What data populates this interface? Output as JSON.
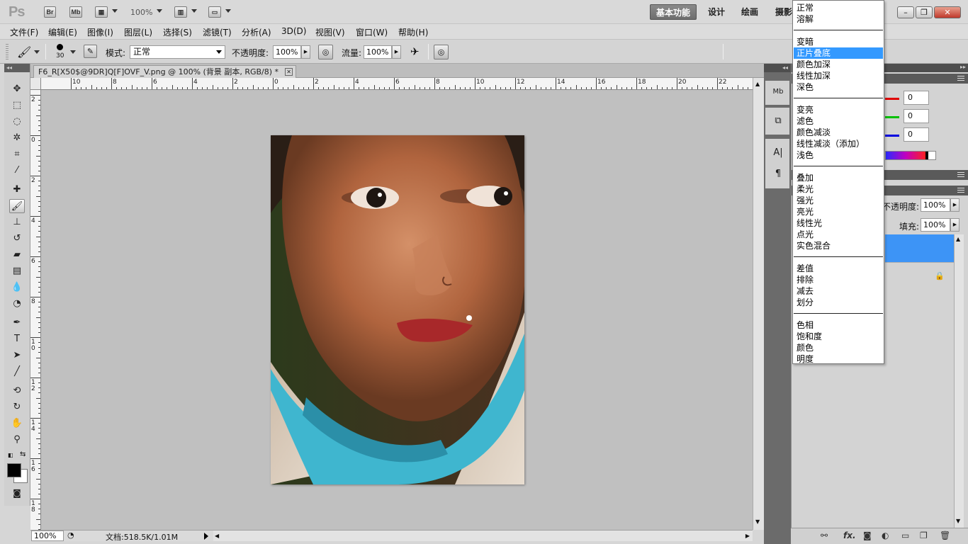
{
  "app": {
    "logo": "Ps",
    "bridge_label": "Br",
    "minibridge_label": "Mb",
    "zoom_level": "100%",
    "workspaces": [
      "基本功能",
      "设计",
      "绘画",
      "摄影"
    ],
    "window_buttons": [
      "–",
      "❐",
      "✕"
    ]
  },
  "menu": [
    "文件(F)",
    "编辑(E)",
    "图像(I)",
    "图层(L)",
    "选择(S)",
    "滤镜(T)",
    "分析(A)",
    "3D(D)",
    "视图(V)",
    "窗口(W)",
    "帮助(H)"
  ],
  "options": {
    "brush_size": "30",
    "mode_label": "模式:",
    "mode_value": "正常",
    "opacity_label": "不透明度:",
    "opacity_value": "100%",
    "flow_label": "流量:",
    "flow_value": "100%"
  },
  "document": {
    "tab_title": "F6_R[X50$@9DR]Q[F]OVF_V.png @ 100% (背景 副本, RGB/8) *",
    "zoom": "100%",
    "doc_info": "文档:518.5K/1.01M",
    "ruler_top": [
      "10",
      "8",
      "6",
      "4",
      "2",
      "0",
      "2",
      "4",
      "6",
      "8",
      "10",
      "12",
      "14",
      "16",
      "18",
      "20",
      "22"
    ],
    "ruler_left": [
      "2",
      "0",
      "2",
      "4",
      "6",
      "8",
      "10",
      "12",
      "14",
      "16",
      "18"
    ]
  },
  "colors": {
    "rgb_values": [
      "0",
      "0",
      "0"
    ],
    "r_color": "#e00000",
    "g_color": "#00c000",
    "b_color": "#0000e0"
  },
  "layers": {
    "opacity_label": "不透明度:",
    "opacity_value": "100%",
    "fill_label": "填充:",
    "fill_value": "100%",
    "footer_icons": [
      "link-icon",
      "fx-icon",
      "mask-icon",
      "adjustment-icon",
      "group-icon",
      "new-layer-icon",
      "trash-icon"
    ],
    "fx_label": "fx."
  },
  "blend_menu": {
    "groups": [
      [
        "正常",
        "溶解"
      ],
      [
        "变暗",
        "正片叠底",
        "颜色加深",
        "线性加深",
        "深色"
      ],
      [
        "变亮",
        "滤色",
        "颜色减淡",
        "线性减淡（添加）",
        "浅色"
      ],
      [
        "叠加",
        "柔光",
        "强光",
        "亮光",
        "线性光",
        "点光",
        "实色混合"
      ],
      [
        "差值",
        "排除",
        "减去",
        "划分"
      ],
      [
        "色相",
        "饱和度",
        "颜色",
        "明度"
      ]
    ],
    "selected": "正片叠底",
    "highlight_color": "#3399ff"
  }
}
